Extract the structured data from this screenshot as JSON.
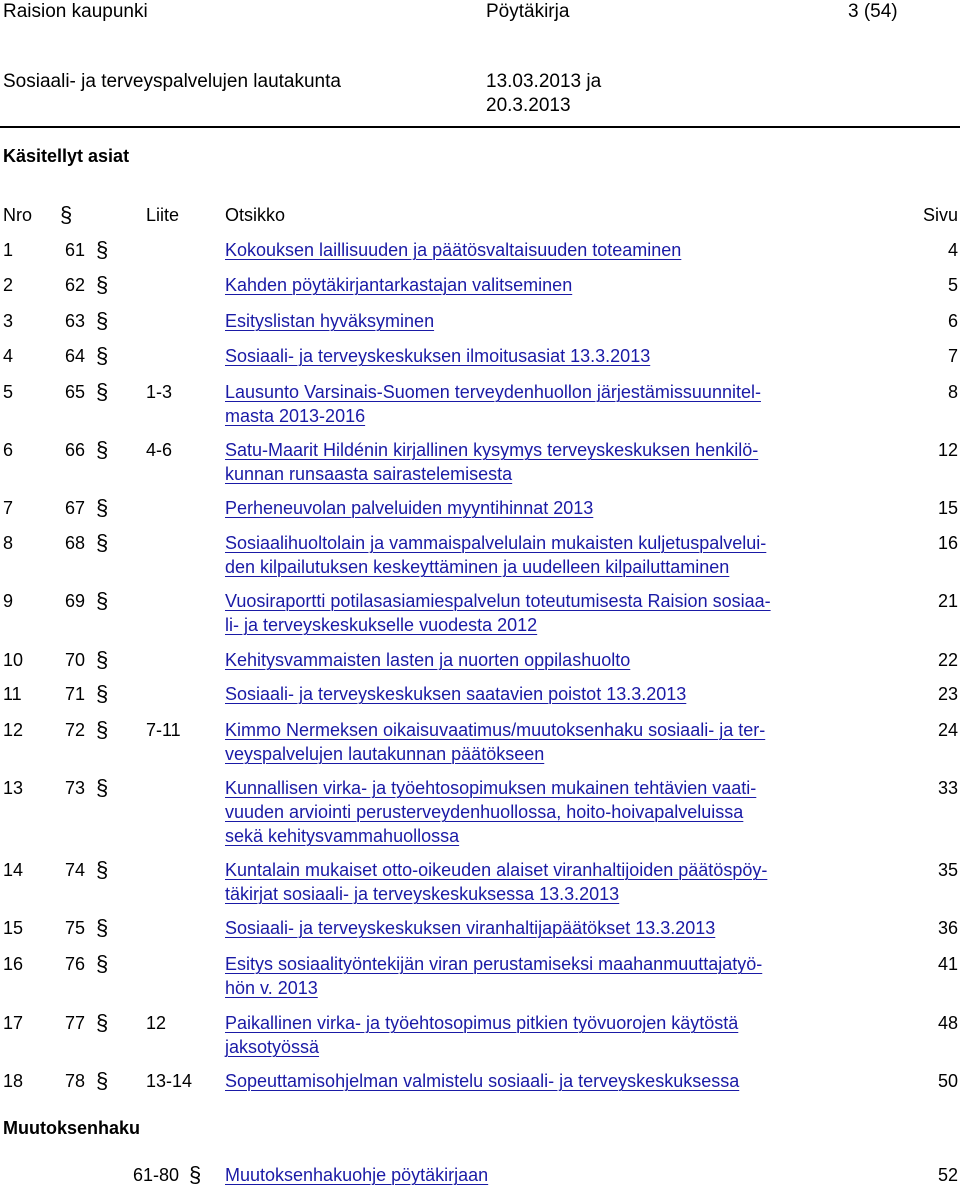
{
  "header": {
    "org": "Raision kaupunki",
    "doc_type": "Pöytäkirja",
    "page": "3 (54)",
    "committee": "Sosiaali- ja terveyspalvelujen lautakunta",
    "date_line1": "13.03.2013 ja",
    "date_line2": "20.3.2013"
  },
  "section_title": "Käsitellyt asiat",
  "columns": {
    "nro": "Nro",
    "sec": "§",
    "liite": "Liite",
    "otsikko": "Otsikko",
    "sivu": "Sivu"
  },
  "items": [
    {
      "nro": "1",
      "pykala": "61",
      "sec": "§",
      "liite": "",
      "line1": "Kokouksen laillisuuden ja päätösvaltaisuuden toteaminen",
      "line2": "",
      "line3": "",
      "sivu": "4"
    },
    {
      "nro": "2",
      "pykala": "62",
      "sec": "§",
      "liite": "",
      "line1": "Kahden pöytäkirjantarkastajan valitseminen",
      "line2": "",
      "line3": "",
      "sivu": "5"
    },
    {
      "nro": "3",
      "pykala": "63",
      "sec": "§",
      "liite": "",
      "line1": "Esityslistan hyväksyminen",
      "line2": "",
      "line3": "",
      "sivu": "6"
    },
    {
      "nro": "4",
      "pykala": "64",
      "sec": "§",
      "liite": "",
      "line1": "Sosiaali- ja terveyskeskuksen ilmoitusasiat 13.3.2013",
      "line2": "",
      "line3": "",
      "sivu": "7"
    },
    {
      "nro": "5",
      "pykala": "65",
      "sec": "§",
      "liite": "1-3",
      "line1": "Lausunto Varsinais-Suomen terveydenhuollon järjestämissuunnitel-",
      "line2": "masta 2013-2016",
      "line3": "",
      "sivu": "8"
    },
    {
      "nro": "6",
      "pykala": "66",
      "sec": "§",
      "liite": "4-6",
      "line1": "Satu-Maarit Hildénin kirjallinen kysymys terveyskeskuksen henkilö-",
      "line2": "kunnan runsaasta sairastelemisesta",
      "line3": "",
      "sivu": "12"
    },
    {
      "nro": "7",
      "pykala": "67",
      "sec": "§",
      "liite": "",
      "line1": "Perheneuvolan palveluiden myyntihinnat 2013",
      "line2": "",
      "line3": "",
      "sivu": "15"
    },
    {
      "nro": "8",
      "pykala": "68",
      "sec": "§",
      "liite": "",
      "line1": "Sosiaalihuoltolain ja vammaispalvelulain mukaisten kuljetuspalvelui-",
      "line2": "den kilpailutuksen keskeyttäminen ja uudelleen kilpailuttaminen",
      "line3": "",
      "sivu": "16"
    },
    {
      "nro": "9",
      "pykala": "69",
      "sec": "§",
      "liite": "",
      "line1": "Vuosiraportti potilasasiamiespalvelun toteutumisesta Raision sosiaa-",
      "line2": "li- ja terveyskeskukselle vuodesta 2012",
      "line3": "",
      "sivu": "21"
    },
    {
      "nro": "10",
      "pykala": "70",
      "sec": "§",
      "liite": "",
      "line1": "Kehitysvammaisten lasten ja nuorten oppilashuolto",
      "line2": "",
      "line3": "",
      "sivu": "22"
    },
    {
      "nro": "11",
      "pykala": "71",
      "sec": "§",
      "liite": "",
      "line1": "Sosiaali- ja terveyskeskuksen saatavien poistot 13.3.2013",
      "line2": "",
      "line3": "",
      "sivu": "23"
    },
    {
      "nro": "12",
      "pykala": "72",
      "sec": "§",
      "liite": "7-11",
      "line1": "Kimmo Nermeksen oikaisuvaatimus/muutoksenhaku sosiaali- ja ter-",
      "line2": "veyspalvelujen lautakunnan päätökseen",
      "line3": "",
      "sivu": "24"
    },
    {
      "nro": "13",
      "pykala": "73",
      "sec": "§",
      "liite": "",
      "line1": "Kunnallisen virka- ja työehtosopimuksen mukainen tehtävien vaati-",
      "line2": "vuuden arviointi perusterveydenhuollossa, hoito-hoivapalveluissa",
      "line3": "sekä kehitysvammahuollossa",
      "sivu": "33"
    },
    {
      "nro": "14",
      "pykala": "74",
      "sec": "§",
      "liite": "",
      "line1": "Kuntalain mukaiset otto-oikeuden alaiset viranhaltijoiden päätöspöy-",
      "line2": "täkirjat sosiaali- ja terveyskeskuksessa 13.3.2013",
      "line3": "",
      "sivu": "35"
    },
    {
      "nro": "15",
      "pykala": "75",
      "sec": "§",
      "liite": "",
      "line1": "Sosiaali- ja terveyskeskuksen viranhaltijapäätökset 13.3.2013",
      "line2": "",
      "line3": "",
      "sivu": "36"
    },
    {
      "nro": "16",
      "pykala": "76",
      "sec": "§",
      "liite": "",
      "line1": "Esitys sosiaalityöntekijän viran perustamiseksi maahanmuuttajatyö-",
      "line2": "hön v. 2013",
      "line3": "",
      "sivu": "41"
    },
    {
      "nro": "17",
      "pykala": "77",
      "sec": "§",
      "liite": "12",
      "line1": "Paikallinen virka- ja työehtosopimus pitkien työvuorojen käytöstä",
      "line2": "jaksotyössä",
      "line3": "",
      "sivu": "48"
    },
    {
      "nro": "18",
      "pykala": "78",
      "sec": "§",
      "liite": "13-14",
      "line1": "Sopeuttamisohjelman valmistelu sosiaali- ja terveyskeskuksessa",
      "line2": "",
      "line3": "",
      "sivu": "50"
    }
  ],
  "appeal": {
    "title": "Muutoksenhaku",
    "pykala": "61-80",
    "sec": "§",
    "text": "Muutoksenhakuohje pöytäkirjaan",
    "sivu": "52"
  }
}
